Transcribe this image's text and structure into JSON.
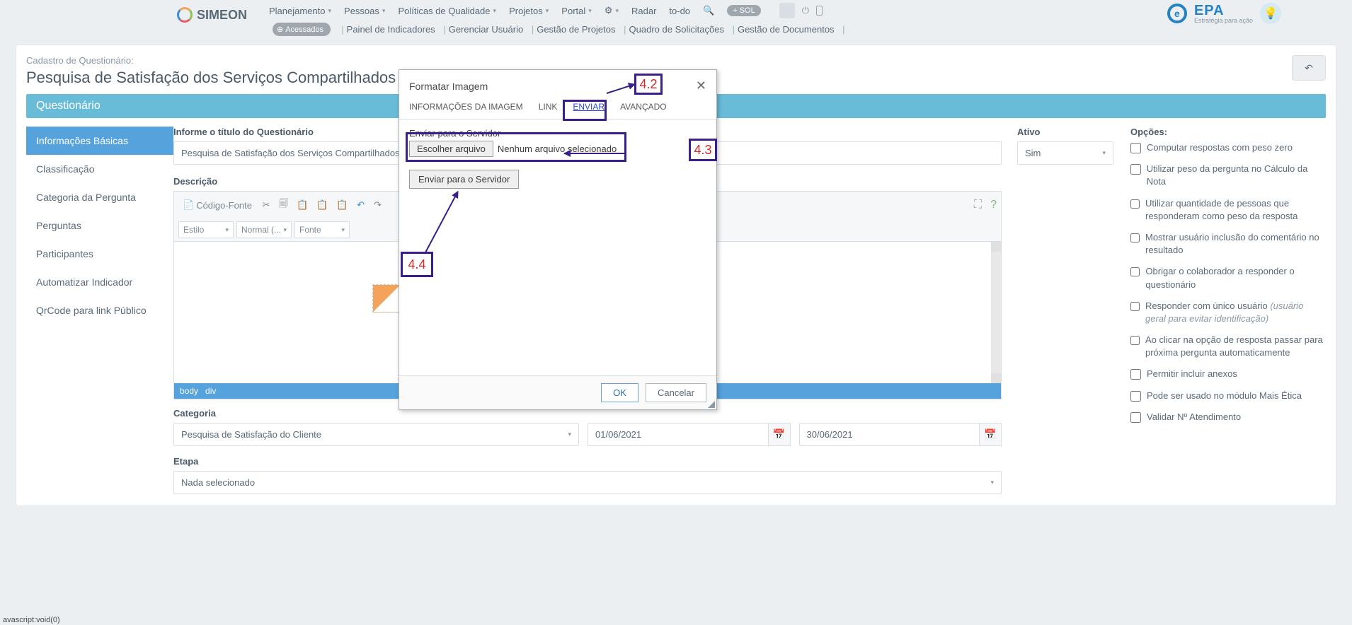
{
  "top_menu": [
    "Planejamento",
    "Pessoas",
    "Políticas de Qualidade",
    "Projetos",
    "Portal",
    "",
    "Radar",
    "to-do"
  ],
  "brand": "SIMEON",
  "sol_badge": "+ SOL",
  "epa": {
    "title": "EPA",
    "sub": "Estratégia para ação"
  },
  "acessados": "Acessados",
  "quick_links": [
    "Painel de Indicadores",
    "Gerenciar Usuário",
    "Gestão de Projetos",
    "Quadro de Solicitações",
    "Gestão de Documentos"
  ],
  "breadcrumb": "Cadastro de Questionário:",
  "page_title": "Pesquisa de Satisfação dos Serviços Compartilhados",
  "section_title": "Questionário",
  "side_tabs": [
    "Informações Básicas",
    "Classificação",
    "Categoria da Pergunta",
    "Perguntas",
    "Participantes",
    "Automatizar Indicador",
    "QrCode para link Público"
  ],
  "form": {
    "titulo_label": "Informe o título do Questionário",
    "titulo_value": "Pesquisa de Satisfação dos Serviços Compartilhados",
    "ativo_label": "Ativo",
    "ativo_value": "Sim",
    "descricao_label": "Descrição",
    "categoria_label": "Categoria",
    "categoria_value": "Pesquisa de Satisfação do Cliente",
    "data_inicio_value": "01/06/2021",
    "data_fim_value": "30/06/2021",
    "etapa_label": "Etapa",
    "etapa_value": "Nada selecionado"
  },
  "ck": {
    "codigo_fonte": "Código-Fonte",
    "estilo": "Estilo",
    "normal": "Normal (...",
    "fonte": "Fonte",
    "path_body": "body",
    "path_div": "div"
  },
  "opcoes_label": "Opções:",
  "opcoes": [
    "Computar respostas com peso zero",
    "Utilizar peso da pergunta no Cálculo da Nota",
    "Utilizar quantidade de pessoas que responderam como peso da resposta",
    "Mostrar usuário inclusão do comentário no resultado",
    "Obrigar o colaborador a responder o questionário",
    "Responder com único usuário (usuário geral para evitar identificação)",
    "Ao clicar na opção de resposta passar para próxima pergunta automaticamente",
    "Permitir incluir anexos",
    "Pode ser usado no módulo Mais Ética",
    "Validar Nº Atendimento"
  ],
  "modal": {
    "title": "Formatar Imagem",
    "tabs": [
      "INFORMAÇÕES DA IMAGEM",
      "LINK",
      "ENVIAR",
      "AVANÇADO"
    ],
    "upload_label": "Enviar para o Servidor",
    "choose_btn": "Escolher arquivo",
    "no_file": "Nenhum arquivo selecionado",
    "send_btn": "Enviar para o Servidor",
    "ok": "OK",
    "cancel": "Cancelar"
  },
  "annotations": {
    "a42": "4.2",
    "a43": "4.3",
    "a44": "4.4"
  },
  "status": "avascript:void(0)"
}
